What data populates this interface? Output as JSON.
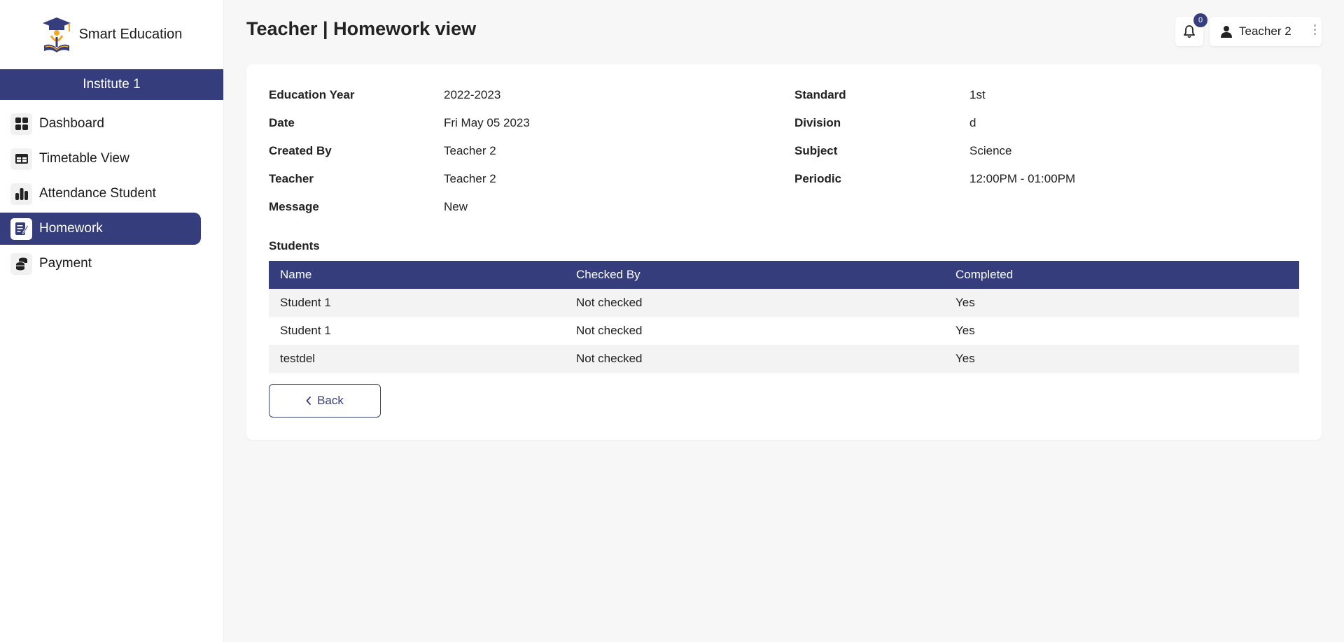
{
  "brand": {
    "name": "Smart Education"
  },
  "institute": {
    "name": "Institute 1"
  },
  "sidebar": {
    "items": [
      {
        "label": "Dashboard",
        "icon": "dashboard-icon"
      },
      {
        "label": "Timetable View",
        "icon": "table-icon"
      },
      {
        "label": "Attendance Student",
        "icon": "bar-chart-icon"
      },
      {
        "label": "Homework",
        "icon": "homework-icon",
        "active": true
      },
      {
        "label": "Payment",
        "icon": "coins-icon"
      }
    ]
  },
  "header": {
    "title": "Teacher | Homework view",
    "notifications_count": "0",
    "user_name": "Teacher 2"
  },
  "details": {
    "education_year": {
      "label": "Education Year",
      "value": "2022-2023"
    },
    "date": {
      "label": "Date",
      "value": "Fri May 05 2023"
    },
    "created_by": {
      "label": "Created By",
      "value": "Teacher 2"
    },
    "teacher": {
      "label": "Teacher",
      "value": "Teacher 2"
    },
    "message": {
      "label": "Message",
      "value": "New"
    },
    "standard": {
      "label": "Standard",
      "value": "1st"
    },
    "division": {
      "label": "Division",
      "value": "d"
    },
    "subject": {
      "label": "Subject",
      "value": "Science"
    },
    "periodic": {
      "label": "Periodic",
      "value": "12:00PM - 01:00PM"
    }
  },
  "students": {
    "title": "Students",
    "columns": [
      "Name",
      "Checked By",
      "Completed"
    ],
    "rows": [
      [
        "Student 1",
        "Not checked",
        "Yes"
      ],
      [
        "Student 1",
        "Not checked",
        "Yes"
      ],
      [
        "testdel",
        "Not checked",
        "Yes"
      ]
    ]
  },
  "actions": {
    "back_label": "Back"
  },
  "colors": {
    "primary": "#363d7c",
    "background": "#f7f7f7",
    "logo_orange": "#f5a623"
  }
}
